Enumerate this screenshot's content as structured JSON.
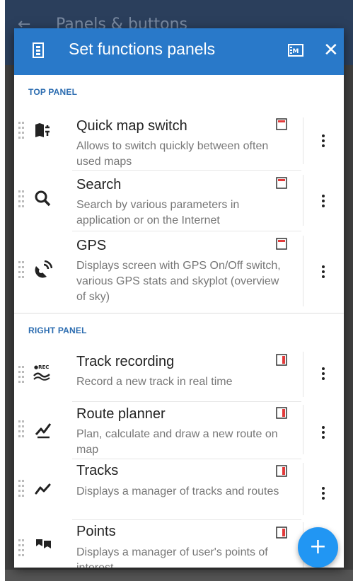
{
  "background": {
    "header_title": "Panels & buttons",
    "back_glyph": "←"
  },
  "dialog": {
    "title": "Set functions panels",
    "close_glyph": "✕",
    "accent_color": "#2979c9"
  },
  "sections": {
    "top": {
      "label": "TOP PANEL",
      "items": [
        {
          "title": "Quick map switch",
          "desc": "Allows to switch quickly between often used maps",
          "icon": "map-switch-icon",
          "panel_icon": "top-panel-icon"
        },
        {
          "title": "Search",
          "desc": "Search by various parameters in application or on the Internet",
          "icon": "search-icon",
          "panel_icon": "top-panel-icon"
        },
        {
          "title": "GPS",
          "desc": "Displays screen with GPS On/Off switch, various GPS stats and skyplot (overview of sky)",
          "icon": "satellite-icon",
          "panel_icon": "top-panel-icon"
        }
      ]
    },
    "right": {
      "label": "RIGHT PANEL",
      "items": [
        {
          "title": "Track recording",
          "desc": "Record a new track in real time",
          "icon": "track-recording-icon",
          "icon_text": "●REC",
          "panel_icon": "right-panel-icon"
        },
        {
          "title": "Route planner",
          "desc": "Plan, calculate and draw a new route on map",
          "icon": "route-planner-icon",
          "panel_icon": "right-panel-icon"
        },
        {
          "title": "Tracks",
          "desc": "Displays a manager of tracks and routes",
          "icon": "tracks-icon",
          "panel_icon": "right-panel-icon"
        },
        {
          "title": "Points",
          "desc": "Displays a manager of user's points of interest",
          "icon": "points-icon",
          "panel_icon": "right-panel-icon"
        }
      ]
    }
  },
  "fab": {
    "glyph": "+",
    "color": "#2196f3"
  }
}
